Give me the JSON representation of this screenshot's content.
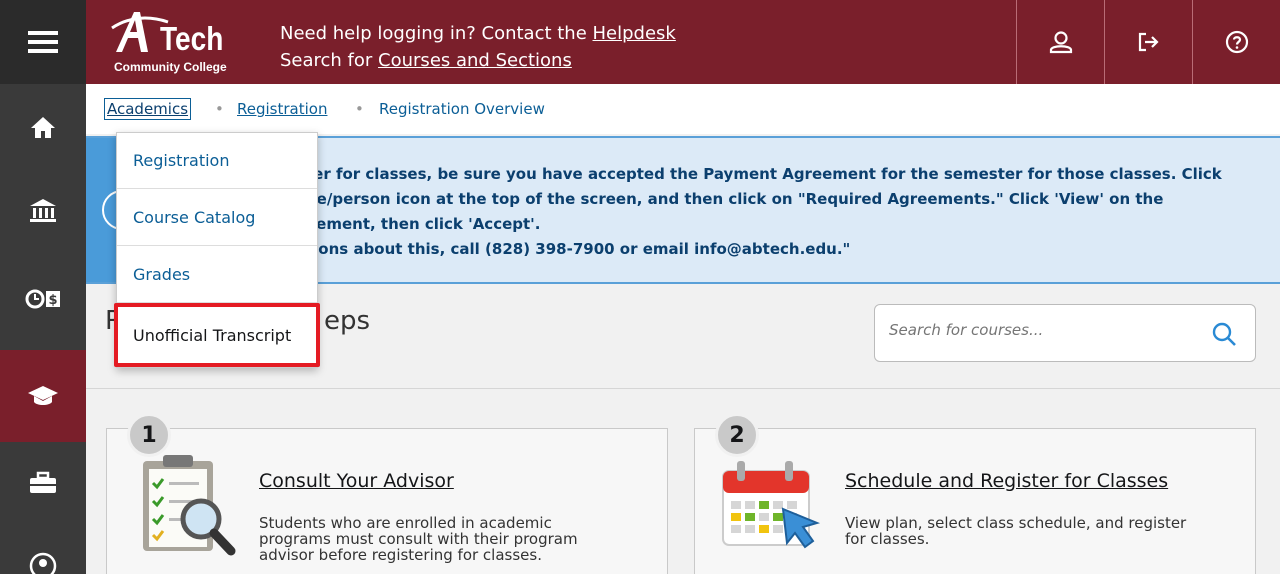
{
  "header": {
    "logo_mark": "AB",
    "logo_word": "Tech",
    "logo_sub": "Community College",
    "help_prefix": "Need help logging in? Contact the ",
    "help_link": "Helpdesk",
    "search_prefix": "Search for ",
    "search_link": "Courses and Sections"
  },
  "breadcrumb": {
    "items": [
      "Academics",
      "Registration",
      "Registration Overview"
    ]
  },
  "dropdown": {
    "items": [
      "Registration",
      "Course Catalog",
      "Grades",
      "Unofficial Transcript"
    ]
  },
  "notice": {
    "lines": [
      "ter for classes, be sure you have accepted the Payment Agreement for the semester for those classes. Click",
      "ne/person icon at the top of the screen, and then click on \"Required Agreements.\" Click 'View' on the",
      "eement, then click 'Accept'.",
      "tions about this, call (828) 398-7900 or email info@abtech.edu.\""
    ]
  },
  "steps": {
    "title_start": "R",
    "title_end": "eps",
    "search_placeholder": "Search for courses..."
  },
  "cards": [
    {
      "number": "1",
      "title": "Consult Your Advisor",
      "desc": [
        "Students who are enrolled in academic",
        "programs must consult with their program",
        "advisor before registering for classes."
      ]
    },
    {
      "number": "2",
      "title": "Schedule and Register for Classes",
      "desc": [
        "View plan, select class schedule, and register",
        "for classes."
      ]
    }
  ],
  "colors": {
    "brand": "#7a1f2b",
    "rail": "#3a3a3a",
    "link": "#0b5e96",
    "notice_bg": "#dceaf7",
    "highlight": "#e41b23"
  }
}
